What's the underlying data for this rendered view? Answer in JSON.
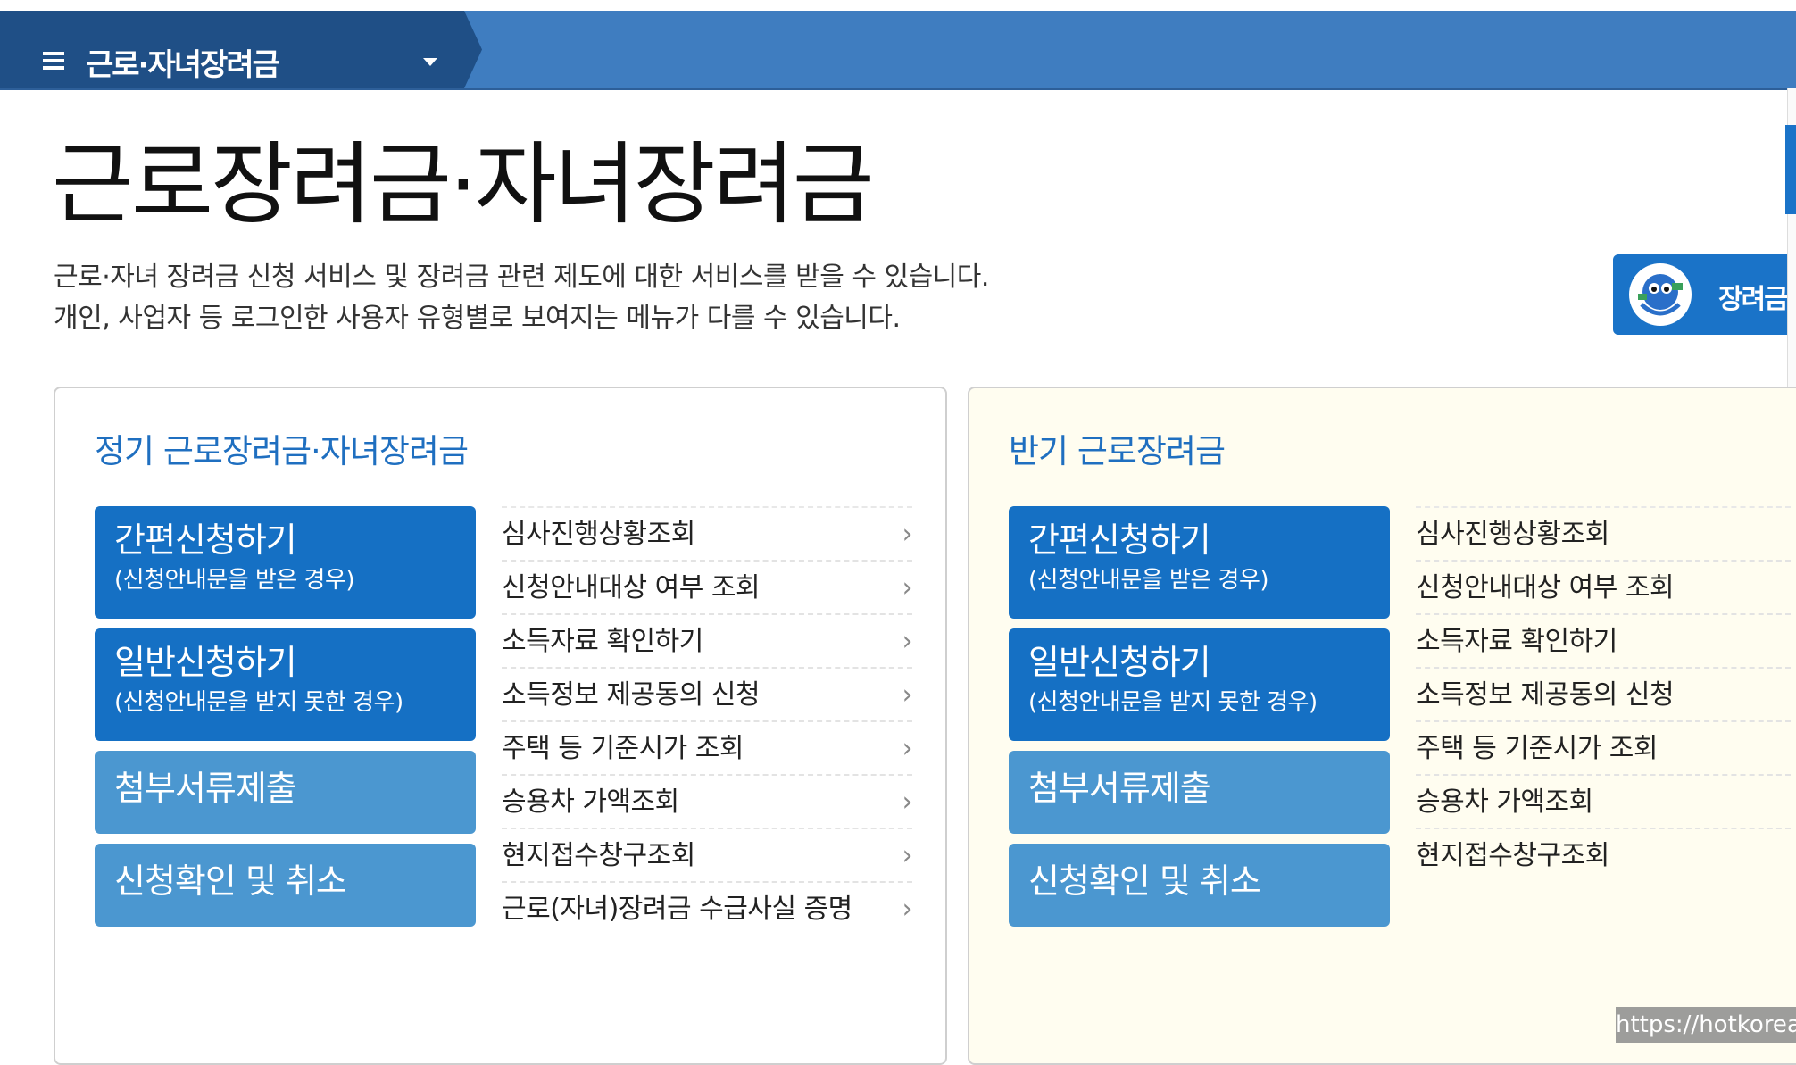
{
  "nav": {
    "menu_label": "근로·자녀장려금"
  },
  "page": {
    "title": "근로장려금·자녀장려금",
    "desc_line1": "근로·자녀 장려금 신청 서비스 및 장려금 관련 제도에 대한 서비스를 받을 수 있습니다.",
    "desc_line2": "개인, 사업자 등 로그인한 사용자 유형별로 보여지는 메뉴가 다를 수 있습니다."
  },
  "badge": {
    "label": "장려금"
  },
  "panels": [
    {
      "title": "정기 근로장려금·자녀장려금",
      "buttons": [
        {
          "title": "간편신청하기",
          "sub": "(신청안내문을 받은 경우)"
        },
        {
          "title": "일반신청하기",
          "sub": "(신청안내문을 받지 못한 경우)"
        },
        {
          "title": "첨부서류제출"
        },
        {
          "title": "신청확인 및 취소"
        }
      ],
      "links": [
        "심사진행상황조회",
        "신청안내대상 여부 조회",
        "소득자료 확인하기",
        "소득정보 제공동의 신청",
        "주택 등 기준시가 조회",
        "승용차 가액조회",
        "현지접수창구조회",
        "근로(자녀)장려금 수급사실 증명"
      ]
    },
    {
      "title": "반기 근로장려금",
      "buttons": [
        {
          "title": "간편신청하기",
          "sub": "(신청안내문을 받은 경우)"
        },
        {
          "title": "일반신청하기",
          "sub": "(신청안내문을 받지 못한 경우)"
        },
        {
          "title": "첨부서류제출"
        },
        {
          "title": "신청확인 및 취소"
        }
      ],
      "links": [
        "심사진행상황조회",
        "신청안내대상 여부 조회",
        "소득자료 확인하기",
        "소득정보 제공동의 신청",
        "주택 등 기준시가 조회",
        "승용차 가액조회",
        "현지접수창구조회"
      ]
    }
  ],
  "link_arrow": "›",
  "watermark": "https://hotkorea.kr",
  "colors": {
    "nav_bar": "#3f7dc0",
    "nav_left": "#1f4f86",
    "primary_button": "#1570c4",
    "secondary_button": "#4b97d0",
    "panel_title": "#1f6fc0",
    "right_panel_bg": "#fffdf0"
  }
}
